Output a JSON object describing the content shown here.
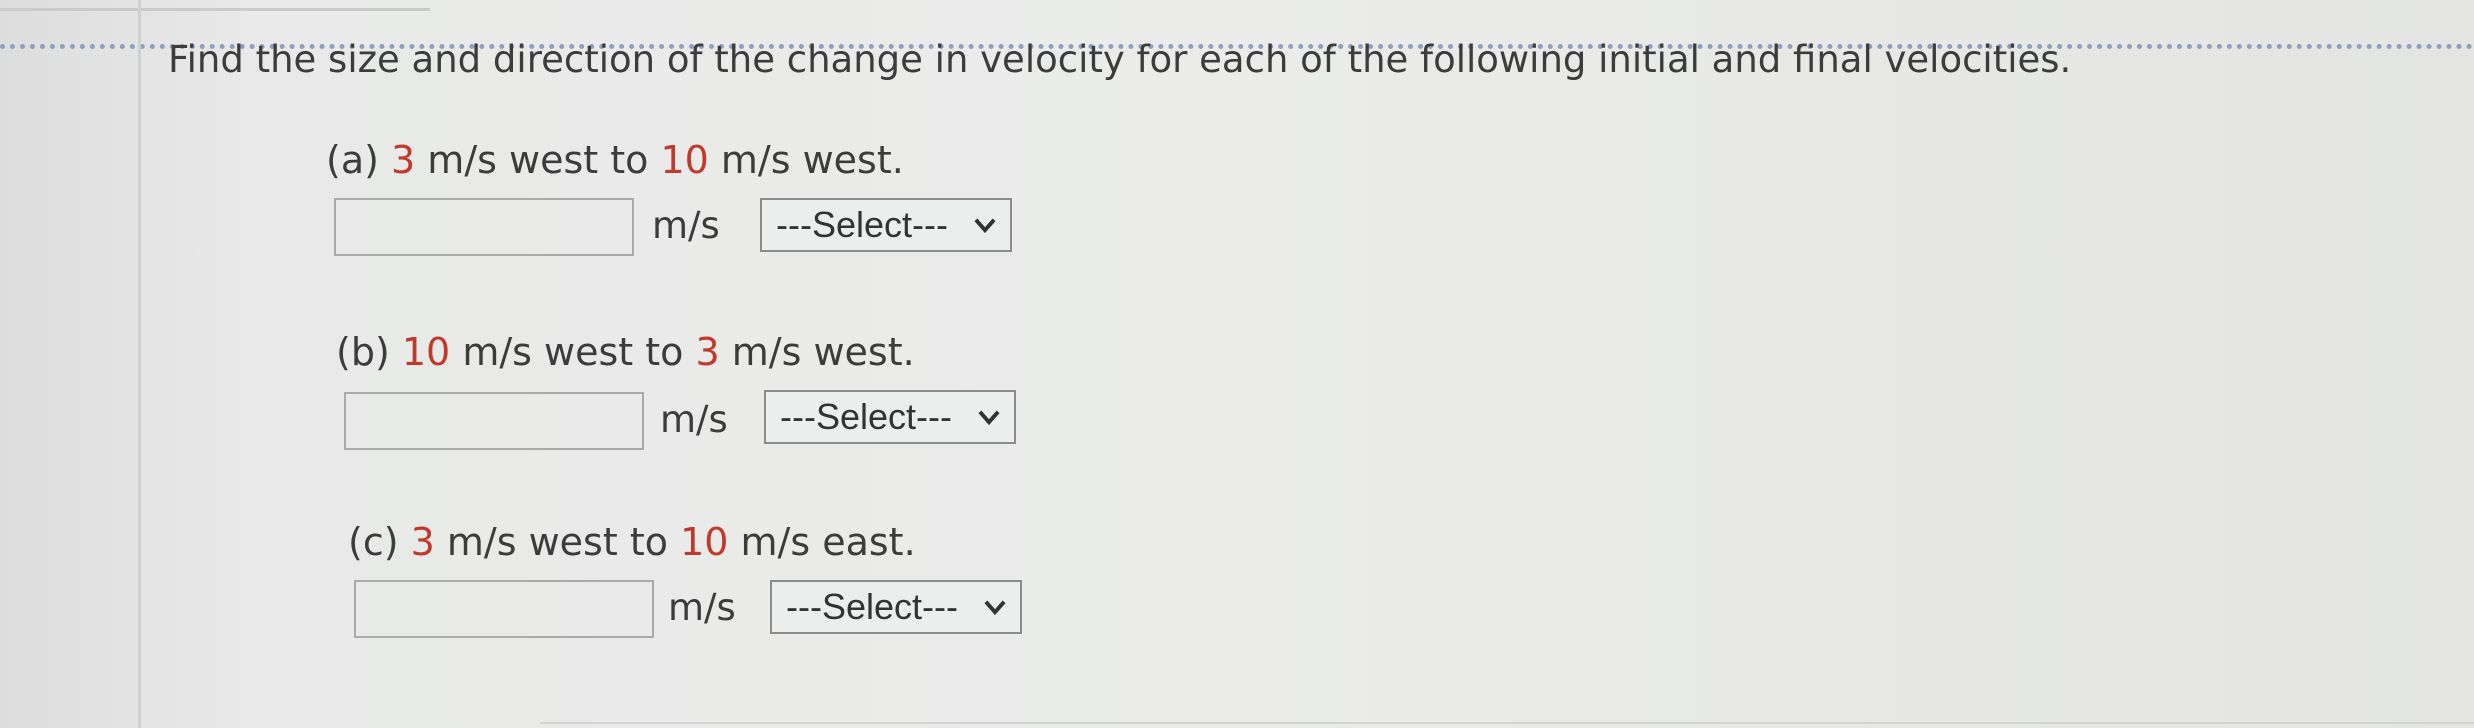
{
  "instructions": "Find the size and direction of the change in velocity for each of the following initial and final velocities.",
  "parts": [
    {
      "letter": "(a)",
      "initial_value": "3",
      "initial_text": " m/s west to ",
      "final_value": "10",
      "final_text": " m/s west.",
      "input_value": "",
      "unit": "m/s",
      "select_value": "---Select---"
    },
    {
      "letter": "(b)",
      "initial_value": "10",
      "initial_text": " m/s west to ",
      "final_value": "3",
      "final_text": " m/s west.",
      "input_value": "",
      "unit": "m/s",
      "select_value": "---Select---"
    },
    {
      "letter": "(c)",
      "initial_value": "3",
      "initial_text": " m/s west to ",
      "final_value": "10",
      "final_text": " m/s east.",
      "input_value": "",
      "unit": "m/s",
      "select_value": "---Select---"
    }
  ],
  "icons": {
    "select_chevron": "chevron-down-icon"
  },
  "colors": {
    "highlight_number": "#c0392b",
    "dotted_rule": "#8f9fbd"
  }
}
